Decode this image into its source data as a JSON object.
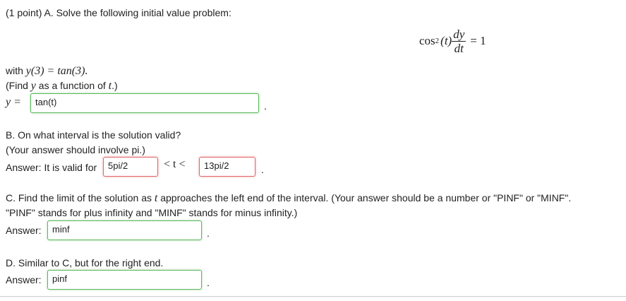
{
  "part_a": {
    "intro": "(1 point) A. Solve the following initial value problem:",
    "ode": {
      "coef_fn": "cos",
      "coef_power": "2",
      "coef_arg": "(t)",
      "numerator": "dy",
      "denominator": "dt",
      "rhs": "= 1"
    },
    "with_label": "with",
    "initial_condition": "y(3) = tan(3).",
    "find_prefix": "(Find",
    "find_var": "y",
    "find_middle": "as a function of",
    "find_arg": "t",
    "find_suffix": ".)",
    "answer_label": "y =",
    "answer_value": "tan(t)",
    "period": "."
  },
  "part_b": {
    "question": "B. On what interval is the solution valid?",
    "hint": "(Your answer should involve pi.)",
    "answer_label": "Answer: It is valid for",
    "lower_value": "5pi/2",
    "inequality": "< t <",
    "upper_value": "13pi/2",
    "period": "."
  },
  "part_c": {
    "question_start": "C. Find the limit of the solution as",
    "question_var": "t",
    "question_end": "approaches the left end of the interval. (Your answer should be a number or \"PINF\" or \"MINF\".",
    "question_line2": "\"PINF\" stands for plus infinity and \"MINF\" stands for minus infinity.)",
    "answer_label": "Answer:",
    "answer_value": "minf",
    "period": "."
  },
  "part_d": {
    "question": "D. Similar to C, but for the right end.",
    "answer_label": "Answer:",
    "answer_value": "pinf",
    "period": "."
  },
  "colors": {
    "correct_border": "#5bb85b",
    "incorrect_border": "#e06666"
  }
}
